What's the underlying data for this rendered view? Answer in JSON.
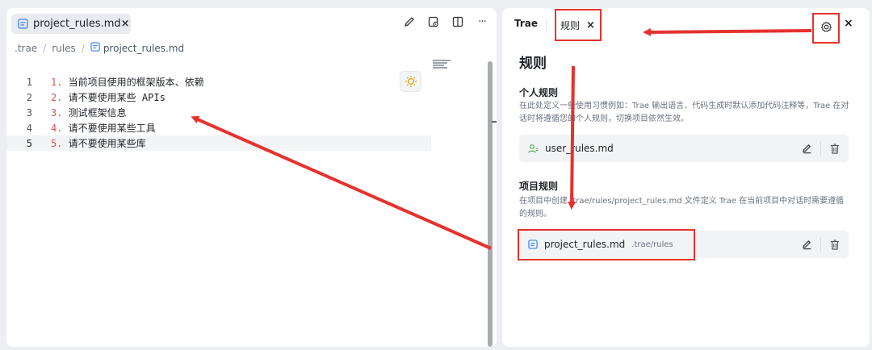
{
  "editor": {
    "tab": {
      "filename": "project_rules.md",
      "close": "×"
    },
    "tools": [
      "edit-icon",
      "preview-icon",
      "split-icon",
      "more-icon"
    ],
    "more_label": "···",
    "breadcrumb": {
      "root": ".trae",
      "folder": "rules",
      "file": "project_rules.md",
      "sep": "/"
    },
    "lines": [
      {
        "n": "1",
        "num": "1.",
        "text": " 当前项目使用的框架版本、依赖"
      },
      {
        "n": "2",
        "num": "2.",
        "text": " 请不要使用某些 APIs"
      },
      {
        "n": "3",
        "num": "3.",
        "text": " 测试框架信息"
      },
      {
        "n": "4",
        "num": "4.",
        "text": " 请不要使用某些工具"
      },
      {
        "n": "5",
        "num": "5.",
        "text": " 请不要使用某些库"
      }
    ]
  },
  "panel": {
    "tabs": {
      "trae": "Trae",
      "rules": "规则",
      "close": "×"
    },
    "close": "×",
    "title": "规则",
    "personal": {
      "title": "个人规则",
      "desc": "在此处定义一些使用习惯例如：Trae 输出语言、代码生成时默认添加代码注释等，Trae 在对话时将遵循您的个人规则，切换项目依然生效。",
      "file": "user_rules.md"
    },
    "project": {
      "title": "项目规则",
      "desc": "在项目中创建 .trae/rules/project_rules.md 文件定义 Trae 在当前项目中对话时需要遵循的规则。",
      "file": "project_rules.md",
      "path": ".trae/rules"
    }
  },
  "colors": {
    "annotation_red": "#e5322d",
    "accent_blue": "#3b82f6",
    "line_number_red": "#d9534f"
  }
}
